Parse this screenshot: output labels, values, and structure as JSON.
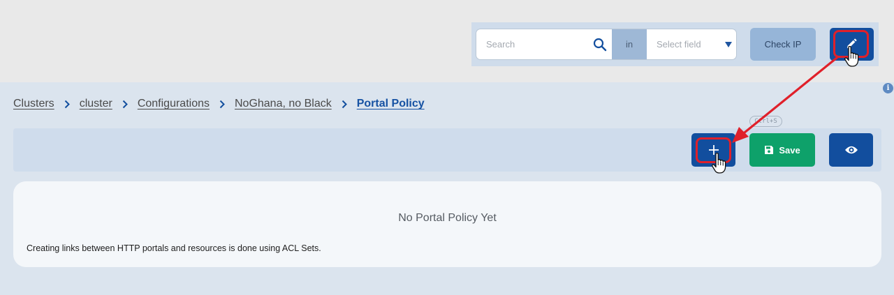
{
  "header": {
    "search": {
      "placeholder": "Search"
    },
    "in_label": "in",
    "select_field": {
      "placeholder": "Select field"
    },
    "check_ip_label": "Check IP",
    "edit_icon": "pencil-icon"
  },
  "info_icon": {
    "glyph": "i"
  },
  "breadcrumb": {
    "items": [
      "Clusters",
      "cluster",
      "Configurations",
      "NoGhana, no Black",
      "Portal Policy"
    ]
  },
  "actions": {
    "shortcut_hint": "Ctrl+S",
    "add_icon": "plus-icon",
    "save_label": "Save",
    "save_icon": "floppy-disk-icon",
    "view_icon": "eye-icon"
  },
  "empty_state": {
    "title": "No Portal Policy Yet",
    "description": "Creating links between HTTP portals and resources is done using ACL Sets."
  },
  "colors": {
    "primary": "#124e9e",
    "success": "#0ea16a",
    "annotation": "#e0202a"
  }
}
